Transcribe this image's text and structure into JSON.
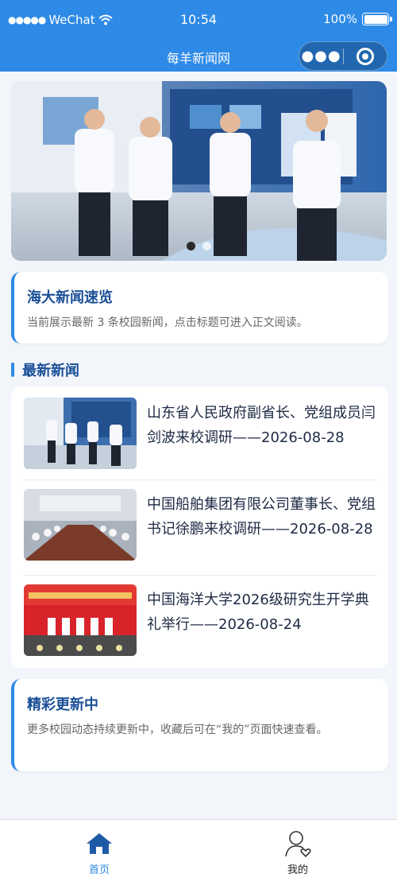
{
  "status_bar": {
    "carrier": "WeChat",
    "time": "10:54",
    "battery": "100%"
  },
  "nav": {
    "title": "每羊新闻网",
    "more_icon": "more-dots-icon",
    "close_icon": "target-icon"
  },
  "banner": {
    "total_slides": 2,
    "active_slide": 1
  },
  "intro_card": {
    "title": "海大新闻速览",
    "desc": "当前展示最新 3 条校园新闻，点击标题可进入正文阅读。"
  },
  "latest": {
    "section_title": "最新新闻",
    "items": [
      {
        "title": "山东省人民政府副省长、党组成员闫剑波来校调研——2026-08-28"
      },
      {
        "title": "中国船舶集团有限公司董事长、党组书记徐鹏来校调研——2026-08-28"
      },
      {
        "title": "中国海洋大学2026级研究生开学典礼举行——2026-08-24"
      }
    ]
  },
  "outro_card": {
    "title": "精彩更新中",
    "desc": "更多校园动态持续更新中，收藏后可在“我的”页面快速查看。"
  },
  "tabbar": {
    "items": [
      {
        "label": "首页",
        "icon": "home-icon",
        "active": true
      },
      {
        "label": "我的",
        "icon": "user-icon",
        "active": false
      }
    ]
  },
  "colors": {
    "primary": "#2d8ae6",
    "title": "#1a4f97",
    "background": "#f2f5fa"
  }
}
